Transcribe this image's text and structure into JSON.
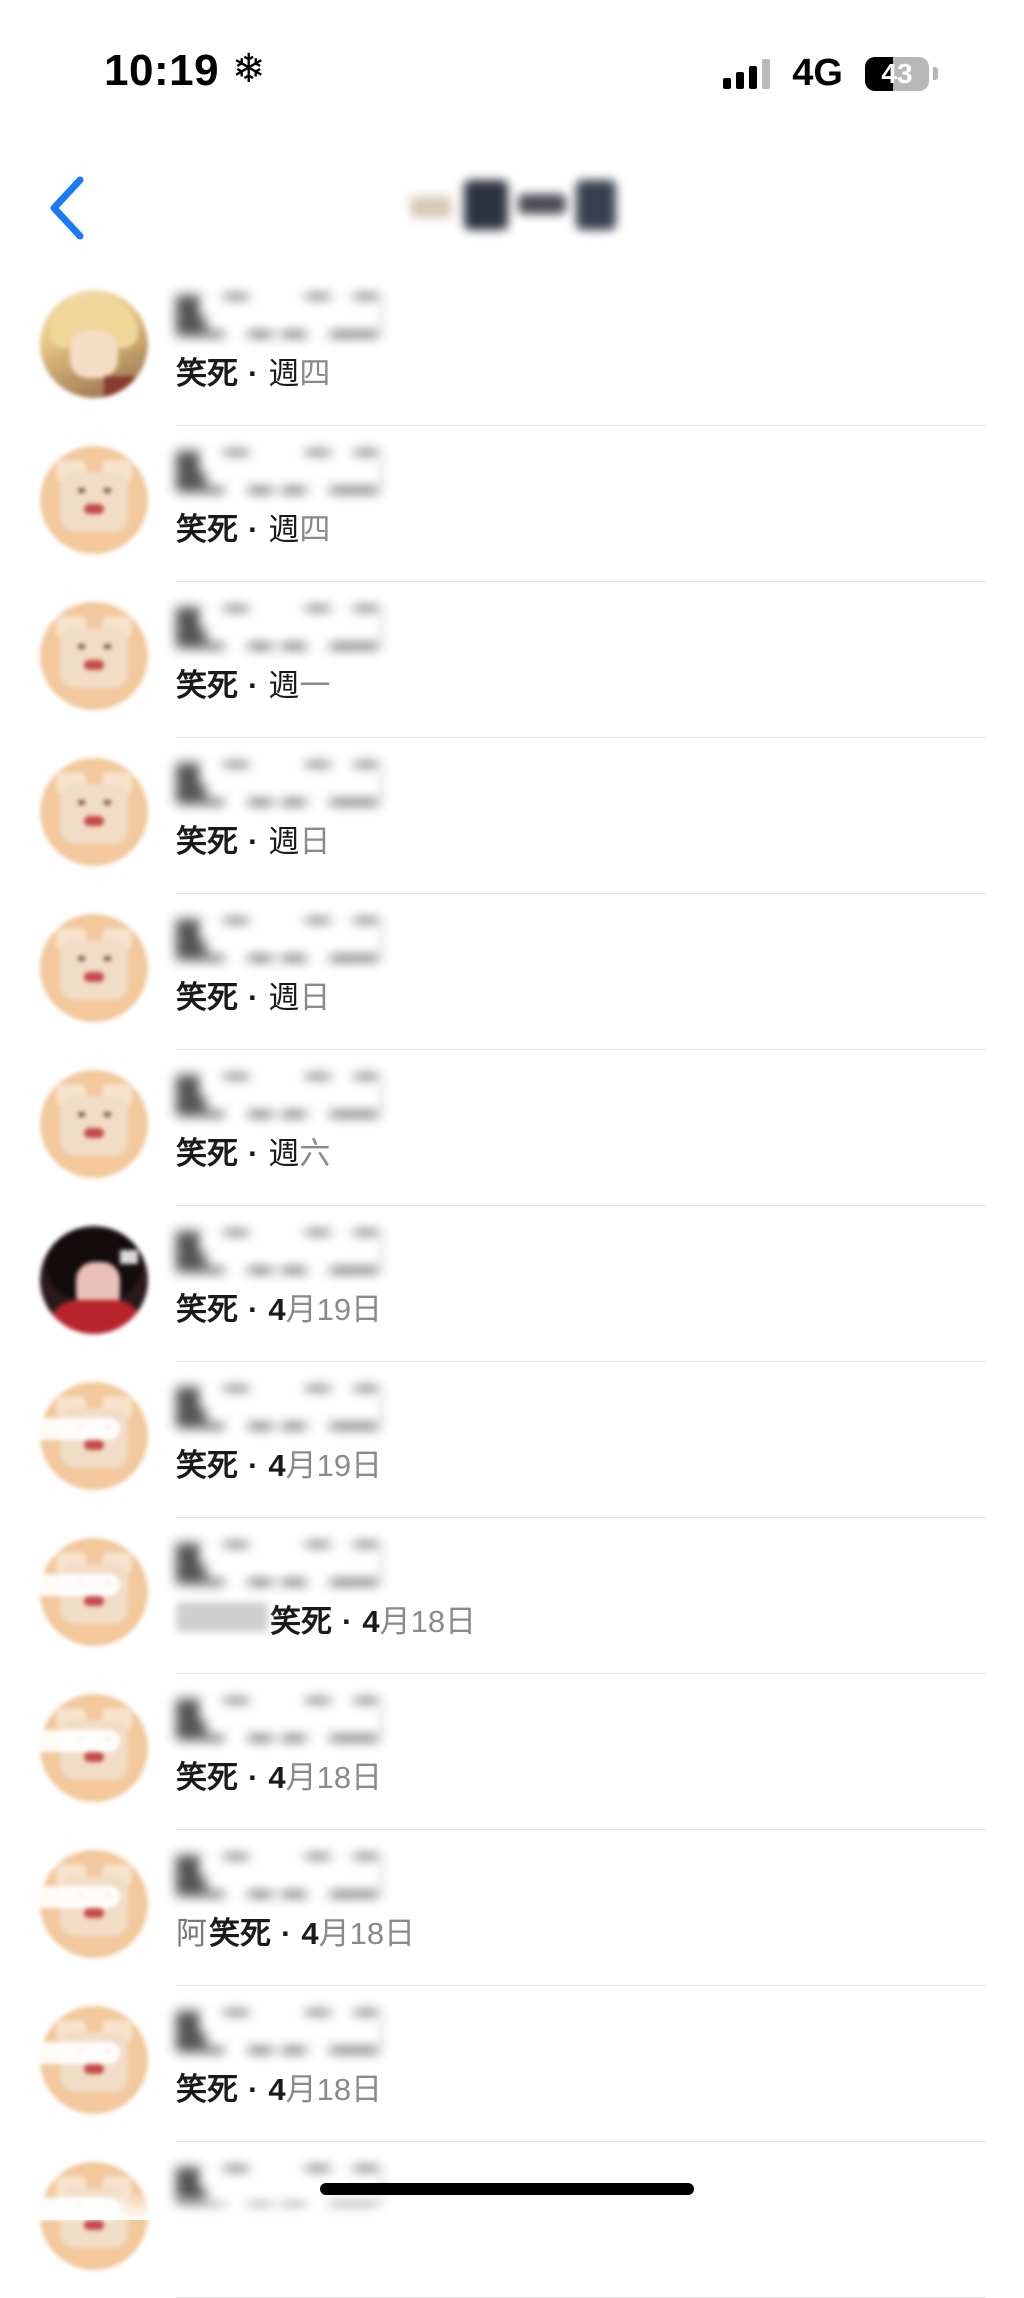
{
  "status_bar": {
    "time": "10:19",
    "time_icon": "snowflake-icon",
    "network": "4G",
    "battery_level": "43",
    "battery_percent": 43
  },
  "nav": {
    "back_icon": "chevron-left-icon",
    "title_blurred": true
  },
  "colors": {
    "accent": "#1a7cf5",
    "divider": "#e3e3e3",
    "secondary_text": "#8a8a8a"
  },
  "list": {
    "items": [
      {
        "avatar": "anime",
        "prefix": "",
        "reaction": "笑死",
        "time_bold": "",
        "time": "週四"
      },
      {
        "avatar": "dog",
        "prefix": "",
        "reaction": "笑死",
        "time_bold": "",
        "time": "週四"
      },
      {
        "avatar": "dog",
        "prefix": "",
        "reaction": "笑死",
        "time_bold": "",
        "time": "週一"
      },
      {
        "avatar": "dog",
        "prefix": "",
        "reaction": "笑死",
        "time_bold": "",
        "time": "週日"
      },
      {
        "avatar": "dog",
        "prefix": "",
        "reaction": "笑死",
        "time_bold": "",
        "time": "週日"
      },
      {
        "avatar": "dog",
        "prefix": "",
        "reaction": "笑死",
        "time_bold": "",
        "time": "週六"
      },
      {
        "avatar": "photo",
        "prefix": "",
        "reaction": "笑死",
        "time_bold": "4",
        "time": "月19日"
      },
      {
        "avatar": "dog-g",
        "prefix": "",
        "reaction": "笑死",
        "time_bold": "4",
        "time": "月19日"
      },
      {
        "avatar": "dog-g",
        "prefix": "blurred",
        "reaction": "笑死",
        "time_bold": "4",
        "time": "月18日"
      },
      {
        "avatar": "dog-g",
        "prefix": "",
        "reaction": "笑死",
        "time_bold": "4",
        "time": "月18日"
      },
      {
        "avatar": "dog-g",
        "prefix": "阿",
        "reaction": "笑死",
        "time_bold": "4",
        "time": "月18日"
      },
      {
        "avatar": "dog-g",
        "prefix": "",
        "reaction": "笑死",
        "time_bold": "4",
        "time": "月18日"
      },
      {
        "avatar": "dog-g",
        "prefix": "",
        "reaction": "",
        "time_bold": "",
        "time": ""
      }
    ]
  }
}
